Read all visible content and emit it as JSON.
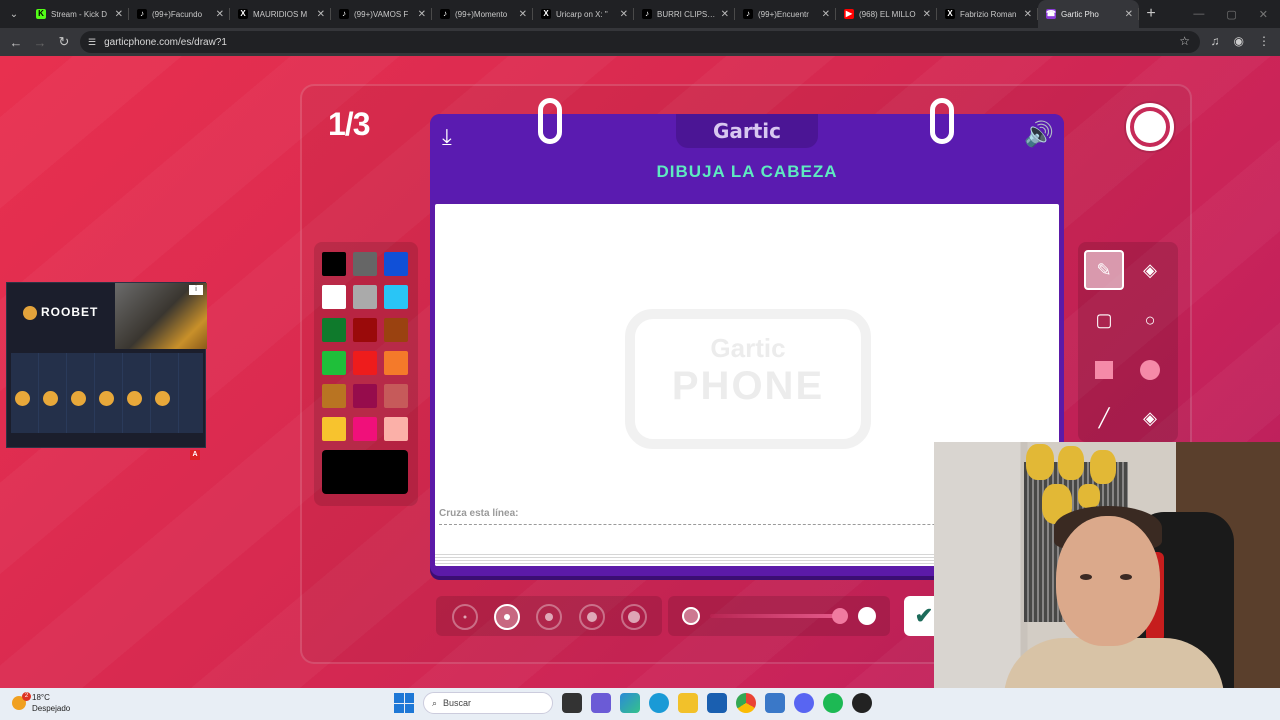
{
  "browser": {
    "tabs": [
      {
        "title": "Stream - Kick D",
        "fav": "K",
        "color": "#53fc18",
        "fg": "#000"
      },
      {
        "title": "(99+)Facundo",
        "fav": "♪",
        "color": "#000",
        "fg": "#fff"
      },
      {
        "title": "MAURIDIOS M",
        "fav": "X",
        "color": "#000",
        "fg": "#fff"
      },
      {
        "title": "(99+)VAMOS F",
        "fav": "♪",
        "color": "#000",
        "fg": "#fff"
      },
      {
        "title": "(99+)Momento",
        "fav": "♪",
        "color": "#000",
        "fg": "#fff"
      },
      {
        "title": "Uricarp on X: \"",
        "fav": "X",
        "color": "#000",
        "fg": "#fff"
      },
      {
        "title": "BURRI CLIPS (@",
        "fav": "♪",
        "color": "#000",
        "fg": "#fff"
      },
      {
        "title": "(99+)Encuentr",
        "fav": "♪",
        "color": "#000",
        "fg": "#fff"
      },
      {
        "title": "(968) EL MILLO",
        "fav": "▶",
        "color": "#ff0000",
        "fg": "#fff"
      },
      {
        "title": "Fabrizio Roman",
        "fav": "X",
        "color": "#000",
        "fg": "#fff"
      },
      {
        "title": "Gartic Pho",
        "fav": "☎",
        "color": "#8a3bd6",
        "fg": "#fff",
        "active": true
      }
    ],
    "url": "garticphone.com/es/draw?1"
  },
  "game": {
    "round": "1/3",
    "logo": "Gartic",
    "prompt": "DIBUJA LA CABEZA",
    "watermark_top": "Gartic",
    "watermark_bottom": "PHONE",
    "cross_line_label": "Cruza esta línea:",
    "palette": [
      "#000000",
      "#666666",
      "#1050d8",
      "#ffffff",
      "#aaaaaa",
      "#29c5f6",
      "#0f7a2c",
      "#9a0a0a",
      "#9a4210",
      "#1fbf3a",
      "#ee1c1c",
      "#f47a2a",
      "#b97422",
      "#960c4c",
      "#c65a5a",
      "#f7c32e",
      "#f0107a",
      "#fbb0a8"
    ],
    "current_color": "#000000",
    "tools": [
      "pen-icon",
      "eraser-icon",
      "rectangle-outline-icon",
      "circle-outline-icon",
      "rectangle-fill-icon",
      "circle-fill-icon",
      "line-icon",
      "fill-bucket-icon"
    ],
    "selected_tool": "pen-icon",
    "brush_sizes": [
      1,
      2,
      3,
      4,
      5
    ],
    "selected_brush_size": 2,
    "opacity": 1.0
  },
  "ad": {
    "brand": "ROOBET",
    "badge": "A"
  },
  "taskbar": {
    "temperature": "18°C",
    "condition": "Despejado",
    "notifications": "2",
    "search_placeholder": "Buscar"
  }
}
